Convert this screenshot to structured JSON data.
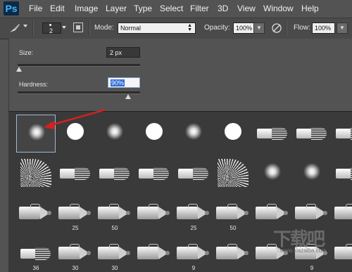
{
  "menubar": {
    "logo": "Ps",
    "items": [
      "File",
      "Edit",
      "Image",
      "Layer",
      "Type",
      "Select",
      "Filter",
      "3D",
      "View",
      "Window",
      "Help"
    ]
  },
  "optionsbar": {
    "brush_size": "2",
    "mode_label": "Mode:",
    "mode_value": "Normal",
    "opacity_label": "Opacity:",
    "opacity_value": "100%",
    "flow_label": "Flow:",
    "flow_value": "100%"
  },
  "brush_panel": {
    "size_label": "Size:",
    "size_value": "2 px",
    "size_level": 0.01,
    "hardness_label": "Hardness:",
    "hardness_value": "90%",
    "hardness_level": 0.9
  },
  "brush_presets": [
    {
      "kind": "soft",
      "label": ""
    },
    {
      "kind": "hard",
      "label": ""
    },
    {
      "kind": "soft",
      "label": ""
    },
    {
      "kind": "hard",
      "label": ""
    },
    {
      "kind": "soft",
      "label": ""
    },
    {
      "kind": "hard",
      "label": ""
    },
    {
      "kind": "brush",
      "label": ""
    },
    {
      "kind": "brush",
      "label": ""
    },
    {
      "kind": "brush",
      "label": ""
    },
    {
      "kind": "fan",
      "label": ""
    },
    {
      "kind": "brush",
      "label": ""
    },
    {
      "kind": "brush",
      "label": ""
    },
    {
      "kind": "brush",
      "label": ""
    },
    {
      "kind": "brush",
      "label": ""
    },
    {
      "kind": "fan",
      "label": ""
    },
    {
      "kind": "soft",
      "label": ""
    },
    {
      "kind": "soft",
      "label": ""
    },
    {
      "kind": "brush",
      "label": ""
    },
    {
      "kind": "pencil",
      "label": ""
    },
    {
      "kind": "pencil",
      "label": "25"
    },
    {
      "kind": "pencil",
      "label": "50"
    },
    {
      "kind": "pencil",
      "label": ""
    },
    {
      "kind": "pencil",
      "label": "25"
    },
    {
      "kind": "pencil",
      "label": "50"
    },
    {
      "kind": "pencil",
      "label": ""
    },
    {
      "kind": "pencil",
      "label": ""
    },
    {
      "kind": "pencil",
      "label": ""
    },
    {
      "kind": "brush",
      "label": "36"
    },
    {
      "kind": "pencil",
      "label": "30"
    },
    {
      "kind": "pencil",
      "label": "30"
    },
    {
      "kind": "pencil",
      "label": ""
    },
    {
      "kind": "pencil",
      "label": "9"
    },
    {
      "kind": "pencil",
      "label": ""
    },
    {
      "kind": "pencil",
      "label": ""
    },
    {
      "kind": "pencil",
      "label": "9"
    },
    {
      "kind": "pencil",
      "label": ""
    }
  ],
  "selected_preset": 0,
  "watermark": {
    "text": "下载吧",
    "url": "www.xiazaiba.com"
  },
  "colors": {
    "selection_arrow": "#d42020",
    "accent": "#2f6bd6"
  }
}
